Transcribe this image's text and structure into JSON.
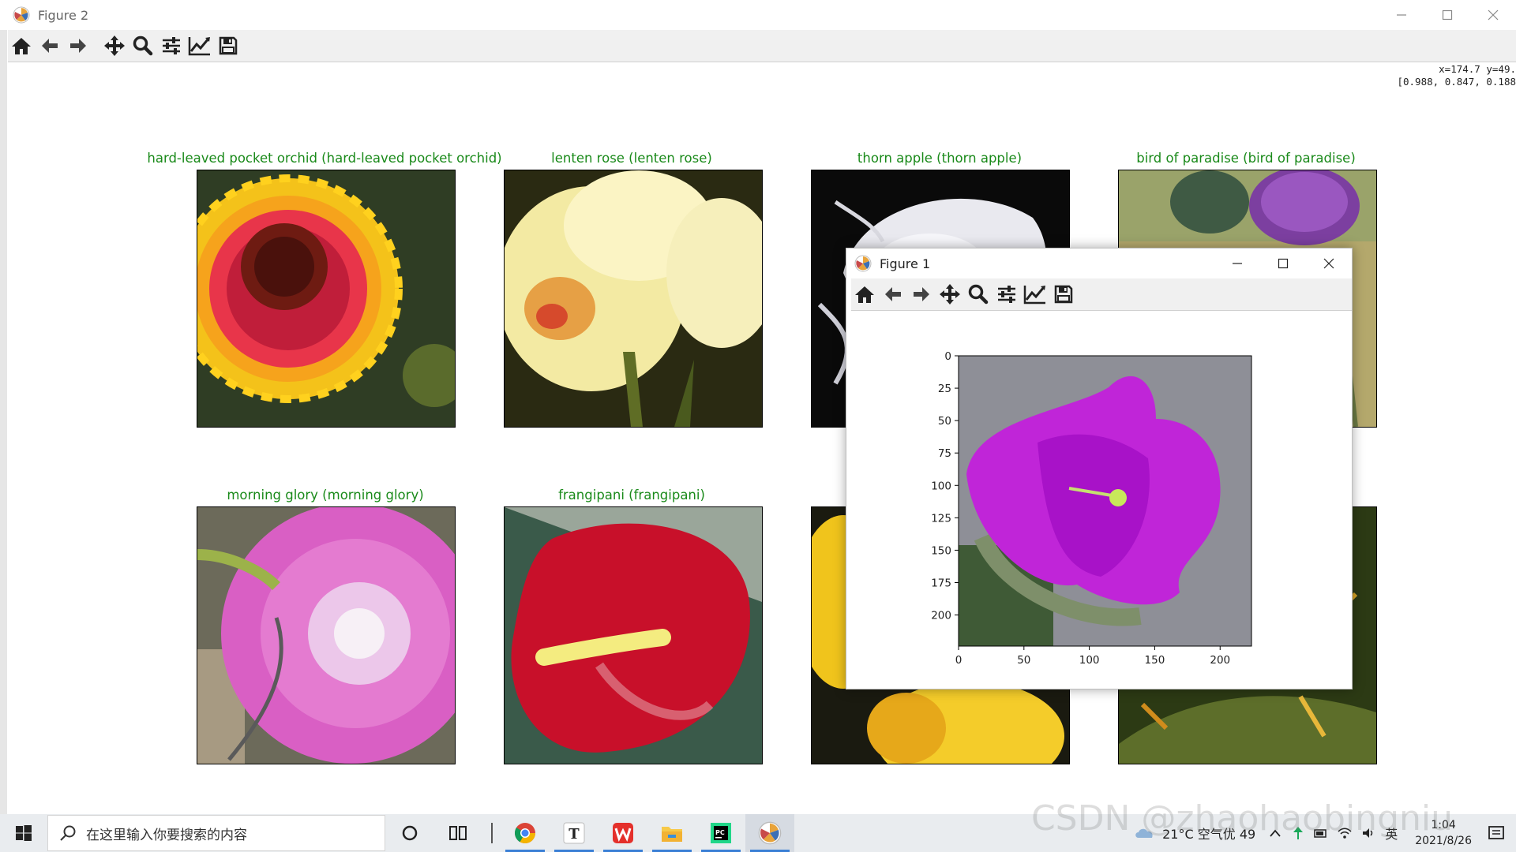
{
  "figure2": {
    "title": "Figure 2",
    "coords_line1": "x=174.7 y=49.",
    "coords_line2": "[0.988, 0.847, 0.188",
    "tiles": [
      {
        "title": "hard-leaved pocket orchid (hard-leaved pocket orchid)",
        "image": "red-yellow-gaillardia-flower"
      },
      {
        "title": "lenten rose (lenten rose)",
        "image": "cream-gladiolus-flowers"
      },
      {
        "title": "thorn apple (thorn apple)",
        "image": "white-datura-flower"
      },
      {
        "title": "bird of paradise (bird of paradise)",
        "image": "purple-thistle-flower"
      },
      {
        "title": "morning glory (morning glory)",
        "image": "pink-morning-glory"
      },
      {
        "title": "frangipani (frangipani)",
        "image": "red-anthurium"
      },
      {
        "title": "",
        "image": "yellow-daffodil"
      },
      {
        "title": "",
        "image": "green-foliage-with-yellow-flower"
      }
    ],
    "title_color": "#1a8a1a"
  },
  "figure1": {
    "title": "Figure 1",
    "image": "purple-bellflower",
    "xticks": [
      "0",
      "50",
      "100",
      "150",
      "200"
    ],
    "yticks": [
      "0",
      "25",
      "50",
      "75",
      "100",
      "125",
      "150",
      "175",
      "200"
    ]
  },
  "toolbar_icons": [
    "home-icon",
    "back-arrow-icon",
    "forward-arrow-icon",
    "pan-move-icon",
    "zoom-magnifier-icon",
    "configure-subplots-icon",
    "edit-axis-icon",
    "save-floppy-icon"
  ],
  "taskbar": {
    "search_placeholder": "在这里输入你要搜索的内容",
    "apps": [
      "cortana-icon",
      "task-view-icon",
      "chrome-icon",
      "typora-icon",
      "wps-icon",
      "file-explorer-icon",
      "pycharm-icon",
      "matplotlib-icon"
    ],
    "weather": "21°C 空气优 49",
    "ime": "英",
    "time": "1:04",
    "date": "2021/8/26",
    "watermark": "CSDN @zhaohaobingniu"
  }
}
